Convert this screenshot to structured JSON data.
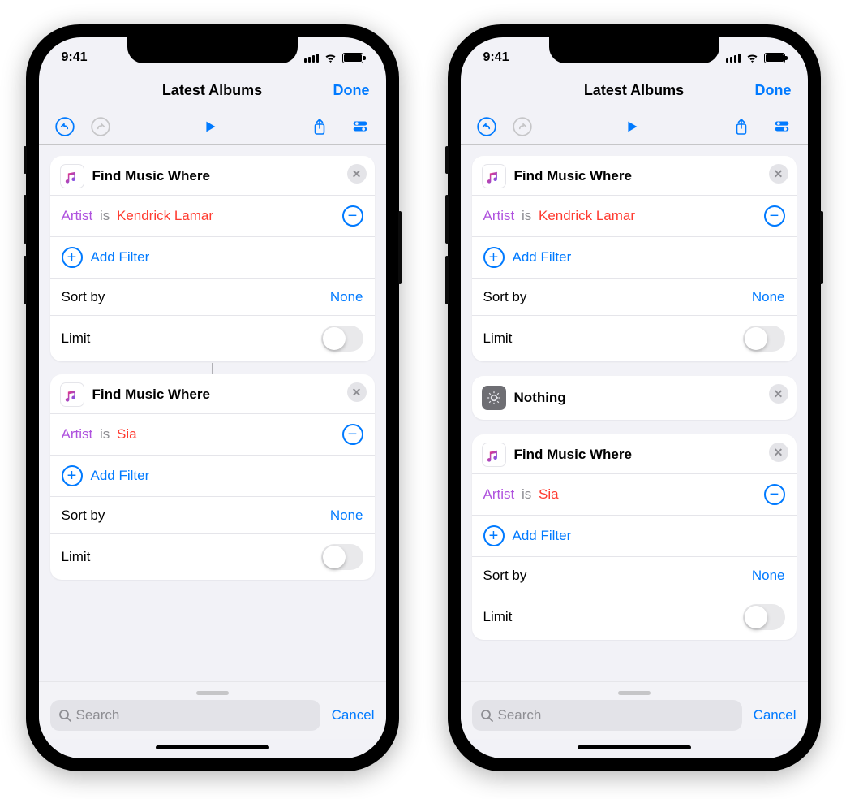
{
  "status": {
    "time": "9:41"
  },
  "nav": {
    "title": "Latest Albums",
    "done": "Done"
  },
  "labels": {
    "find_music": "Find Music Where",
    "add_filter": "Add Filter",
    "sort_by": "Sort by",
    "none": "None",
    "limit": "Limit",
    "nothing": "Nothing",
    "search_placeholder": "Search",
    "cancel": "Cancel"
  },
  "filter_tokens": {
    "artist": "Artist",
    "is": "is"
  },
  "phone1": {
    "cards": {
      "artist1": "Kendrick Lamar",
      "artist2": "Sia"
    }
  },
  "phone2": {
    "cards": {
      "artist1": "Kendrick Lamar",
      "artist2": "Sia"
    }
  }
}
